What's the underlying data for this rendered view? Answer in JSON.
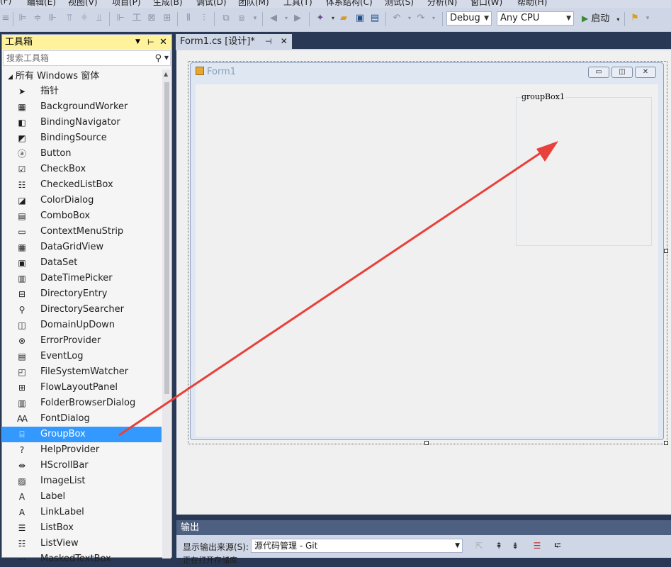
{
  "menu": [
    "(F)",
    "编辑(E)",
    "视图(V)",
    "项目(P)",
    "生成(B)",
    "调试(D)",
    "团队(M)",
    "工具(T)",
    "体系结构(C)",
    "测试(S)",
    "分析(N)",
    "窗口(W)",
    "帮助(H)"
  ],
  "toolbar": {
    "config": "Debug",
    "platform": "Any CPU",
    "start": "启动"
  },
  "toolbox": {
    "title": "工具箱",
    "search_placeholder": "搜索工具箱",
    "group": "所有 Windows 窗体",
    "items": [
      {
        "label": "指针",
        "icon": "pointer-icon"
      },
      {
        "label": "BackgroundWorker",
        "icon": "background-worker-icon"
      },
      {
        "label": "BindingNavigator",
        "icon": "binding-navigator-icon"
      },
      {
        "label": "BindingSource",
        "icon": "binding-source-icon"
      },
      {
        "label": "Button",
        "icon": "button-icon"
      },
      {
        "label": "CheckBox",
        "icon": "checkbox-icon"
      },
      {
        "label": "CheckedListBox",
        "icon": "checked-listbox-icon"
      },
      {
        "label": "ColorDialog",
        "icon": "color-dialog-icon"
      },
      {
        "label": "ComboBox",
        "icon": "combobox-icon"
      },
      {
        "label": "ContextMenuStrip",
        "icon": "context-menu-icon"
      },
      {
        "label": "DataGridView",
        "icon": "datagrid-icon"
      },
      {
        "label": "DataSet",
        "icon": "dataset-icon"
      },
      {
        "label": "DateTimePicker",
        "icon": "datetime-icon"
      },
      {
        "label": "DirectoryEntry",
        "icon": "directory-entry-icon"
      },
      {
        "label": "DirectorySearcher",
        "icon": "directory-searcher-icon"
      },
      {
        "label": "DomainUpDown",
        "icon": "domain-updown-icon"
      },
      {
        "label": "ErrorProvider",
        "icon": "error-provider-icon"
      },
      {
        "label": "EventLog",
        "icon": "eventlog-icon"
      },
      {
        "label": "FileSystemWatcher",
        "icon": "filesystem-watcher-icon"
      },
      {
        "label": "FlowLayoutPanel",
        "icon": "flowlayout-icon"
      },
      {
        "label": "FolderBrowserDialog",
        "icon": "folder-browser-icon"
      },
      {
        "label": "FontDialog",
        "icon": "font-dialog-icon"
      },
      {
        "label": "GroupBox",
        "icon": "groupbox-icon"
      },
      {
        "label": "HelpProvider",
        "icon": "help-provider-icon"
      },
      {
        "label": "HScrollBar",
        "icon": "hscrollbar-icon"
      },
      {
        "label": "ImageList",
        "icon": "imagelist-icon"
      },
      {
        "label": "Label",
        "icon": "label-icon"
      },
      {
        "label": "LinkLabel",
        "icon": "linklabel-icon"
      },
      {
        "label": "ListBox",
        "icon": "listbox-icon"
      },
      {
        "label": "ListView",
        "icon": "listview-icon"
      },
      {
        "label": "MaskedTextBox",
        "icon": "masked-textbox-icon"
      }
    ],
    "selected": "GroupBox"
  },
  "document": {
    "tab": "Form1.cs [设计]*",
    "form_title": "Form1",
    "groupbox_label": "groupBox1"
  },
  "output": {
    "title": "输出",
    "source_label": "显示输出来源(S):",
    "source_value": "源代码管理 - Git",
    "partial_text": "正在打开存储库"
  },
  "colors": {
    "selection": "#3399ff",
    "annotation_arrow": "#e8403a",
    "toolbox_header": "#fff29d"
  }
}
